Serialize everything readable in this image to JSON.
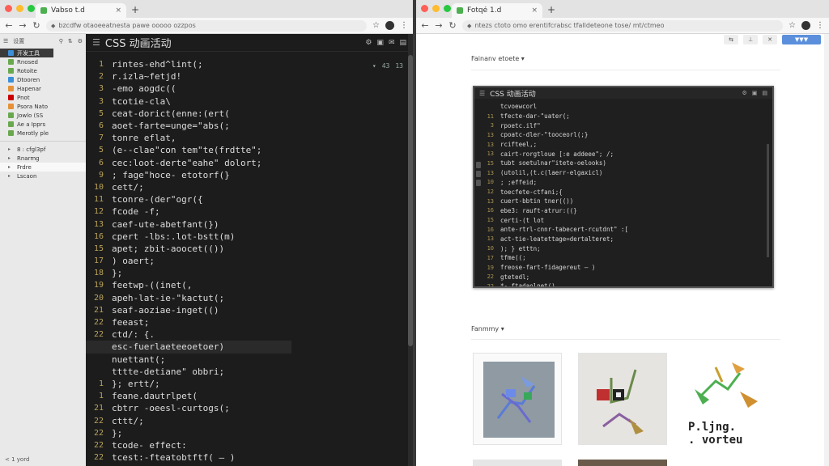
{
  "left_window": {
    "tab_title": "Vabso t.d",
    "tab_close": "×",
    "newtab": "+",
    "url": "bzcdfw otaoeeatnesta pawe ooooo ozzpos",
    "sidebar": {
      "header_label": "设置",
      "items": [
        {
          "label": "开发工具",
          "color": "#3b8fd9",
          "style": "dark"
        },
        {
          "label": "Rnosed",
          "color": "#6aa84f",
          "style": ""
        },
        {
          "label": "Rotoite",
          "color": "#6aa84f",
          "style": ""
        },
        {
          "label": "Dtooren",
          "color": "#3b8fd9",
          "style": ""
        },
        {
          "label": "Hapenar",
          "color": "#e69138",
          "style": ""
        },
        {
          "label": "Pnot",
          "color": "#cc0000",
          "style": ""
        },
        {
          "label": "Psora Nato",
          "color": "#e69138",
          "style": ""
        },
        {
          "label": "Jowlo (SS",
          "color": "#6aa84f",
          "style": ""
        },
        {
          "label": "Ae a Ipprs",
          "color": "#6aa84f",
          "style": ""
        },
        {
          "label": "Merotly ple",
          "color": "#6aa84f",
          "style": ""
        },
        {
          "label": "8 : cfgl3pf",
          "color": "",
          "style": ""
        },
        {
          "label": "Rnarmg",
          "color": "",
          "style": ""
        },
        {
          "label": "Frdre",
          "color": "",
          "style": "sel"
        },
        {
          "label": "Lscaon",
          "color": "",
          "style": ""
        }
      ],
      "footer": "< 1 yord"
    },
    "editor": {
      "title": "CSS 动画活动",
      "toolbar": [
        "⚙",
        "▣",
        "✉",
        "▤"
      ],
      "topright": [
        "▾",
        "43",
        "13"
      ],
      "lines": [
        {
          "n": "1",
          "t": "rintes-ehd^lint(;"
        },
        {
          "n": "2",
          "t": "r.izla~fetjd!"
        },
        {
          "n": "3",
          "t": "      -emo aogdc(("
        },
        {
          "n": "3",
          "t": "tcotie-cla\\"
        },
        {
          "n": "5",
          "t": "  ceat-dorict(enne:(ert("
        },
        {
          "n": "6",
          "t": "  aoet-farte=unge=\"abs(;"
        },
        {
          "n": "7",
          "t": "tonre eflat,"
        },
        {
          "n": "5",
          "t": "  (e--clae\"con  tem\"te(frdtte\";"
        },
        {
          "n": "6",
          "t": "  cec:loot-derte\"eahe\" dolort;"
        },
        {
          "n": "9",
          "t": "  ;  fage\"hoce- etotorf(}"
        },
        {
          "n": "10",
          "t": "   cett/;"
        },
        {
          "n": "11",
          "t": "tconre-(der\"ogr({"
        },
        {
          "n": "12",
          "t": "fcode -f;"
        },
        {
          "n": "13",
          "t": "   caef-ute-abetfant(})"
        },
        {
          "n": "16",
          "t": "   cpert -lbs:.lot-bstt(m)"
        },
        {
          "n": "15",
          "t": "   apet; zbit-aoocet(())"
        },
        {
          "n": "17",
          "t": ")     oaert;"
        },
        {
          "n": "18",
          "t": "};"
        },
        {
          "n": "19",
          "t": "   feetwp-((inet(,"
        },
        {
          "n": "20",
          "t": "  apeh-lat-ie-\"kactut(;"
        },
        {
          "n": "21",
          "t": "  seaf-aoziae-inget(()"
        },
        {
          "n": "22",
          "t": "       feeast;"
        },
        {
          "n": "22",
          "t": "ctd/: {."
        },
        {
          "n": "",
          "t": "esc-fuerlaeteeoetoer)",
          "hl": true
        },
        {
          "n": "",
          "t": "  nuettant(;"
        },
        {
          "n": "",
          "t": "  tttte-detiane\" obbri;"
        },
        {
          "n": "1",
          "t": "}; ertt/;"
        },
        {
          "n": "1",
          "t": "feane.dautrlpet("
        },
        {
          "n": "21",
          "t": "  cbtrr -oeesl-curtogs(;"
        },
        {
          "n": "22",
          "t": "  cttt/;"
        },
        {
          "n": "22",
          "t": "};"
        },
        {
          "n": "22",
          "t": "tcode- effect:"
        },
        {
          "n": "22",
          "t": "   tcest:-fteatobtftf( — )"
        }
      ]
    }
  },
  "right_window": {
    "tab_title": "Fotqé 1.d",
    "tab_close": "×",
    "newtab": "+",
    "url": "ntezs ctoto omo erentifcrabsc tfalldeteone tose/ mt/ctmeo",
    "page_toolbar": [
      "⇆",
      "⊥",
      "✕",
      "▼▼▼"
    ],
    "section1": "Fainanv etoete ▾",
    "section2": "Fanmmy ▾",
    "shot": {
      "title": "CSS 动画活动",
      "head_icons": [
        "⚙",
        "▣",
        "▤"
      ],
      "lines": [
        {
          "n": "",
          "t": "tcvoewcorl"
        },
        {
          "n": "11",
          "t": "  tfecte-dar-\"uater(;"
        },
        {
          "n": "3",
          "t": "  rpoetc.ilf\""
        },
        {
          "n": "13",
          "t": "  cpoatc-dler-\"tooceorl(;}"
        },
        {
          "n": "13",
          "t": "  rcifteel,;"
        },
        {
          "n": "13",
          "t": "    cairt-rorgtloue [:e addeee\"; /;"
        },
        {
          "n": "15",
          "t": "    tubt  soetulnar\"itete-oelooks)"
        },
        {
          "n": "13",
          "t": "    (utolil,(t.c(laerr-elgaxicl)"
        },
        {
          "n": "10",
          "t": "    ;  ;effeid;"
        },
        {
          "n": "12",
          "t": "    toecfete-ctfani;{"
        },
        {
          "n": "13",
          "t": "      cuert-bbtin tner(())"
        },
        {
          "n": "16",
          "t": "      ebe3: rauft-atrur:((}"
        },
        {
          "n": "15",
          "t": "      certi-(t   lot"
        },
        {
          "n": "16",
          "t": "      ante-rtrl-cnnr-tabecert-rcutdnt\"  :["
        },
        {
          "n": "13",
          "t": "      act-tie-leatettage=dertalteret;"
        },
        {
          "n": "10",
          "t": "   ); } etttn;"
        },
        {
          "n": "17",
          "t": "  tfme((;"
        },
        {
          "n": "19",
          "t": "  freose-fart-fidagereut  — )"
        },
        {
          "n": "22",
          "t": "     gtetedl;"
        },
        {
          "n": "22",
          "t": "     *-  ftadaolnet()"
        }
      ]
    },
    "logo_text_line1": "P.ljng.",
    "logo_text_line2": ". vorteu"
  }
}
